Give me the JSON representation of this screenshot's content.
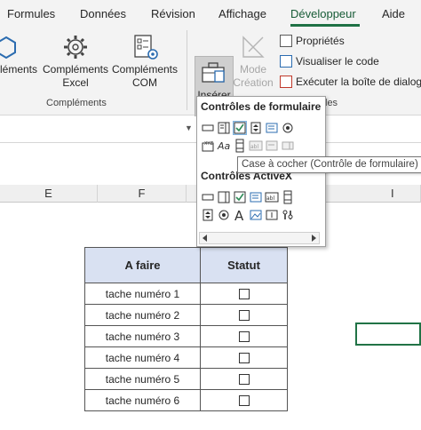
{
  "tabs": [
    "Formules",
    "Données",
    "Révision",
    "Affichage",
    "Développeur",
    "Aide"
  ],
  "active_tab": "Développeur",
  "ribbon": {
    "addins_partial": "léments",
    "addins_excel": [
      "Compléments",
      "Excel"
    ],
    "addins_com": [
      "Compléments",
      "COM"
    ],
    "group_addins": "Compléments",
    "insert": "Insérer",
    "design_mode": [
      "Mode",
      "Création"
    ],
    "properties": "Propriétés",
    "view_code": "Visualiser le code",
    "run_dialog": "Exécuter la boîte de dialogue",
    "group_controls_partial": "les"
  },
  "columns": [
    "E",
    "F",
    "I"
  ],
  "panel": {
    "form_controls_title": "Contrôles de formulaire",
    "activex_title": "Contrôles ActiveX"
  },
  "tooltip": "Case à cocher (Contrôle de formulaire)",
  "table": {
    "headers": [
      "A faire",
      "Statut"
    ],
    "rows": [
      "tache numéro 1",
      "tache numéro 2",
      "tache numéro 3",
      "tache numéro 4",
      "tache numéro 5",
      "tache numéro 6"
    ]
  },
  "colors": {
    "accent": "#1e7145",
    "header_fill": "#d9e1f2",
    "selection": "#217346"
  }
}
